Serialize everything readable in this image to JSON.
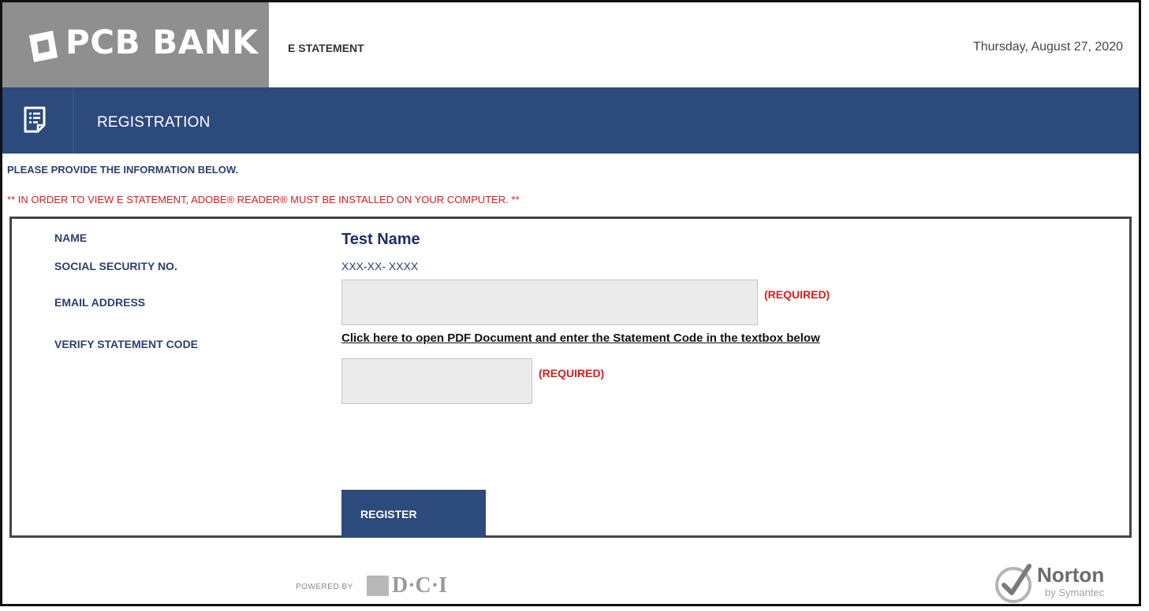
{
  "header": {
    "logo_text": "PCB BANK",
    "app_name": "E STATEMENT",
    "date": "Thursday, August 27, 2020"
  },
  "nav": {
    "title": "REGISTRATION",
    "icon": "document-list-icon"
  },
  "instructions": "PLEASE PROVIDE THE INFORMATION BELOW.",
  "warning": "** IN ORDER TO VIEW E STATEMENT, ADOBE® READER® MUST BE INSTALLED ON YOUR COMPUTER. **",
  "form": {
    "name_label": "NAME",
    "name_value": "Test Name",
    "ssn_label": "SOCIAL SECURITY NO.",
    "ssn_value": "XXX-XX- XXXX",
    "email_label": "EMAIL ADDRESS",
    "email_value": "",
    "email_required": "(REQUIRED)",
    "code_label": "VERIFY STATEMENT CODE",
    "pdf_link": "Click here to open PDF Document and enter the Statement Code in the textbox below",
    "code_value": "",
    "code_required": "(REQUIRED)",
    "register_label": "REGISTER"
  },
  "footer": {
    "powered_by": "POWERED BY",
    "vendor": "D·C·I",
    "norton": "Norton",
    "norton_sub": "by Symantec"
  },
  "colors": {
    "brand_blue": "#2c4a7c",
    "logo_gray": "#8f8f8f",
    "warning_red": "#e01b1b",
    "label_navy": "#2c3f6e"
  }
}
